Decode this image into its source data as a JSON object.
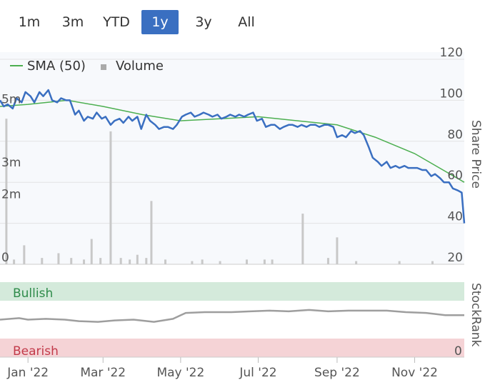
{
  "range_selector": {
    "buttons": [
      {
        "label": "1m",
        "active": false
      },
      {
        "label": "3m",
        "active": false
      },
      {
        "label": "YTD",
        "active": false
      },
      {
        "label": "1y",
        "active": true
      },
      {
        "label": "3y",
        "active": false
      },
      {
        "label": "All",
        "active": false
      }
    ]
  },
  "colors": {
    "price": "#3a6fc1",
    "sma": "#4caf50",
    "volume": "#c8c8c8",
    "stockrank": "#9e9e9e",
    "bullish_bg": "#d4eadb",
    "bearish_bg": "#f5d3d6",
    "bullish_text": "#2e8b4a",
    "bearish_text": "#c23a4a"
  },
  "chart_data": {
    "type": "line",
    "legend": {
      "sma_label": "SMA (50)",
      "volume_label": "Volume",
      "placement": "top-left"
    },
    "x_axis": {
      "ticks": [
        "Jan '22",
        "Mar '22",
        "May '22",
        "Jul '22",
        "Sep '22",
        "Nov '22"
      ],
      "tick_dates": [
        "2022-01-01",
        "2022-03-01",
        "2022-05-01",
        "2022-07-01",
        "2022-09-01",
        "2022-11-01"
      ],
      "range": [
        "2021-12-10",
        "2022-12-10"
      ]
    },
    "price_axis": {
      "title": "Share Price",
      "ticks": [
        20,
        40,
        60,
        80,
        100,
        120
      ],
      "ylim": [
        20,
        120
      ]
    },
    "volume_axis": {
      "ticks": [
        "0",
        "2m",
        "3m",
        "5m"
      ],
      "tick_values": [
        0,
        2,
        3,
        5
      ],
      "ylim": [
        0,
        5.8
      ]
    },
    "price_series": {
      "name": "Share Price",
      "points": [
        [
          "2021-12-10",
          100
        ],
        [
          "2021-12-13",
          97
        ],
        [
          "2021-12-16",
          98
        ],
        [
          "2021-12-20",
          96
        ],
        [
          "2021-12-23",
          101
        ],
        [
          "2021-12-27",
          99
        ],
        [
          "2021-12-30",
          104
        ],
        [
          "2022-01-03",
          102
        ],
        [
          "2022-01-06",
          99
        ],
        [
          "2022-01-10",
          104
        ],
        [
          "2022-01-13",
          102
        ],
        [
          "2022-01-17",
          105
        ],
        [
          "2022-01-20",
          100
        ],
        [
          "2022-01-24",
          99
        ],
        [
          "2022-01-27",
          101
        ],
        [
          "2022-01-31",
          100
        ],
        [
          "2022-02-03",
          100
        ],
        [
          "2022-02-07",
          93
        ],
        [
          "2022-02-10",
          95
        ],
        [
          "2022-02-14",
          90
        ],
        [
          "2022-02-17",
          92
        ],
        [
          "2022-02-21",
          91
        ],
        [
          "2022-02-24",
          94
        ],
        [
          "2022-02-28",
          91
        ],
        [
          "2022-03-03",
          92
        ],
        [
          "2022-03-07",
          88
        ],
        [
          "2022-03-10",
          90
        ],
        [
          "2022-03-14",
          91
        ],
        [
          "2022-03-17",
          89
        ],
        [
          "2022-03-21",
          92
        ],
        [
          "2022-03-24",
          90
        ],
        [
          "2022-03-28",
          92
        ],
        [
          "2022-03-31",
          86
        ],
        [
          "2022-04-04",
          93
        ],
        [
          "2022-04-07",
          90
        ],
        [
          "2022-04-11",
          88
        ],
        [
          "2022-04-14",
          86
        ],
        [
          "2022-04-18",
          87
        ],
        [
          "2022-04-21",
          87
        ],
        [
          "2022-04-25",
          86
        ],
        [
          "2022-04-28",
          88
        ],
        [
          "2022-05-02",
          92
        ],
        [
          "2022-05-05",
          93
        ],
        [
          "2022-05-09",
          94
        ],
        [
          "2022-05-12",
          92
        ],
        [
          "2022-05-16",
          93
        ],
        [
          "2022-05-19",
          94
        ],
        [
          "2022-05-23",
          93
        ],
        [
          "2022-05-26",
          92
        ],
        [
          "2022-05-30",
          93
        ],
        [
          "2022-06-02",
          91
        ],
        [
          "2022-06-06",
          92
        ],
        [
          "2022-06-09",
          93
        ],
        [
          "2022-06-13",
          92
        ],
        [
          "2022-06-16",
          93
        ],
        [
          "2022-06-20",
          92
        ],
        [
          "2022-06-23",
          93
        ],
        [
          "2022-06-27",
          94
        ],
        [
          "2022-06-30",
          90
        ],
        [
          "2022-07-04",
          91
        ],
        [
          "2022-07-07",
          87
        ],
        [
          "2022-07-11",
          88
        ],
        [
          "2022-07-14",
          88
        ],
        [
          "2022-07-18",
          86
        ],
        [
          "2022-07-21",
          87
        ],
        [
          "2022-07-25",
          88
        ],
        [
          "2022-07-28",
          88
        ],
        [
          "2022-08-01",
          87
        ],
        [
          "2022-08-04",
          88
        ],
        [
          "2022-08-08",
          87
        ],
        [
          "2022-08-11",
          88
        ],
        [
          "2022-08-15",
          88
        ],
        [
          "2022-08-18",
          87
        ],
        [
          "2022-08-22",
          88
        ],
        [
          "2022-08-25",
          88
        ],
        [
          "2022-08-29",
          87
        ],
        [
          "2022-09-01",
          82
        ],
        [
          "2022-09-05",
          83
        ],
        [
          "2022-09-08",
          82
        ],
        [
          "2022-09-12",
          85
        ],
        [
          "2022-09-15",
          84
        ],
        [
          "2022-09-19",
          85
        ],
        [
          "2022-09-22",
          83
        ],
        [
          "2022-09-26",
          77
        ],
        [
          "2022-09-29",
          72
        ],
        [
          "2022-10-03",
          70
        ],
        [
          "2022-10-06",
          68
        ],
        [
          "2022-10-10",
          70
        ],
        [
          "2022-10-13",
          67
        ],
        [
          "2022-10-17",
          68
        ],
        [
          "2022-10-20",
          67
        ],
        [
          "2022-10-24",
          68
        ],
        [
          "2022-10-27",
          67
        ],
        [
          "2022-10-31",
          67
        ],
        [
          "2022-11-03",
          67
        ],
        [
          "2022-11-07",
          66
        ],
        [
          "2022-11-10",
          66
        ],
        [
          "2022-11-14",
          63
        ],
        [
          "2022-11-17",
          64
        ],
        [
          "2022-11-21",
          62
        ],
        [
          "2022-11-24",
          60
        ],
        [
          "2022-11-28",
          60
        ],
        [
          "2022-12-01",
          57
        ],
        [
          "2022-12-05",
          56
        ],
        [
          "2022-12-08",
          55
        ],
        [
          "2022-12-10",
          40
        ]
      ]
    },
    "sma_series": {
      "name": "SMA (50)",
      "points": [
        [
          "2021-12-10",
          97
        ],
        [
          "2022-01-01",
          98
        ],
        [
          "2022-02-01",
          100
        ],
        [
          "2022-03-01",
          97
        ],
        [
          "2022-04-01",
          93
        ],
        [
          "2022-05-01",
          90
        ],
        [
          "2022-06-01",
          91
        ],
        [
          "2022-07-01",
          92
        ],
        [
          "2022-08-01",
          90
        ],
        [
          "2022-09-01",
          88
        ],
        [
          "2022-10-01",
          82
        ],
        [
          "2022-11-01",
          74
        ],
        [
          "2022-12-10",
          60
        ]
      ]
    },
    "volume_series": {
      "name": "Volume",
      "unit": "m",
      "bars": [
        [
          "2021-12-15",
          4.6
        ],
        [
          "2021-12-21",
          0.15
        ],
        [
          "2021-12-29",
          0.6
        ],
        [
          "2022-01-12",
          0.2
        ],
        [
          "2022-01-25",
          0.35
        ],
        [
          "2022-02-04",
          0.2
        ],
        [
          "2022-02-14",
          0.15
        ],
        [
          "2022-02-20",
          0.8
        ],
        [
          "2022-02-27",
          0.2
        ],
        [
          "2022-03-07",
          4.2
        ],
        [
          "2022-03-15",
          0.2
        ],
        [
          "2022-03-22",
          0.15
        ],
        [
          "2022-03-28",
          0.3
        ],
        [
          "2022-04-04",
          0.2
        ],
        [
          "2022-04-08",
          2.0
        ],
        [
          "2022-04-19",
          0.15
        ],
        [
          "2022-05-10",
          0.1
        ],
        [
          "2022-05-18",
          0.15
        ],
        [
          "2022-06-01",
          0.1
        ],
        [
          "2022-06-22",
          0.15
        ],
        [
          "2022-07-06",
          0.15
        ],
        [
          "2022-07-12",
          0.15
        ],
        [
          "2022-08-05",
          1.6
        ],
        [
          "2022-08-25",
          0.2
        ],
        [
          "2022-09-01",
          0.85
        ],
        [
          "2022-09-16",
          0.1
        ],
        [
          "2022-10-20",
          0.1
        ],
        [
          "2022-11-15",
          0.1
        ]
      ]
    },
    "stockrank_series": {
      "name": "StockRank",
      "title": "StockRank",
      "zones": {
        "top": "Bullish",
        "bottom": "Bearish"
      },
      "tick_bottom": "0",
      "ylim": [
        0,
        100
      ],
      "points": [
        [
          "2021-12-10",
          50
        ],
        [
          "2021-12-25",
          52
        ],
        [
          "2022-01-01",
          50
        ],
        [
          "2022-01-15",
          51
        ],
        [
          "2022-01-30",
          50
        ],
        [
          "2022-02-10",
          48
        ],
        [
          "2022-02-25",
          47
        ],
        [
          "2022-03-10",
          49
        ],
        [
          "2022-03-25",
          50
        ],
        [
          "2022-04-10",
          47
        ],
        [
          "2022-04-25",
          51
        ],
        [
          "2022-05-05",
          59
        ],
        [
          "2022-05-20",
          60
        ],
        [
          "2022-06-10",
          60
        ],
        [
          "2022-06-25",
          61
        ],
        [
          "2022-07-10",
          62
        ],
        [
          "2022-07-25",
          61
        ],
        [
          "2022-08-10",
          63
        ],
        [
          "2022-08-25",
          61
        ],
        [
          "2022-09-10",
          62
        ],
        [
          "2022-09-25",
          62
        ],
        [
          "2022-10-10",
          62
        ],
        [
          "2022-10-25",
          60
        ],
        [
          "2022-11-10",
          59
        ],
        [
          "2022-11-25",
          56
        ],
        [
          "2022-12-10",
          56
        ]
      ]
    }
  }
}
